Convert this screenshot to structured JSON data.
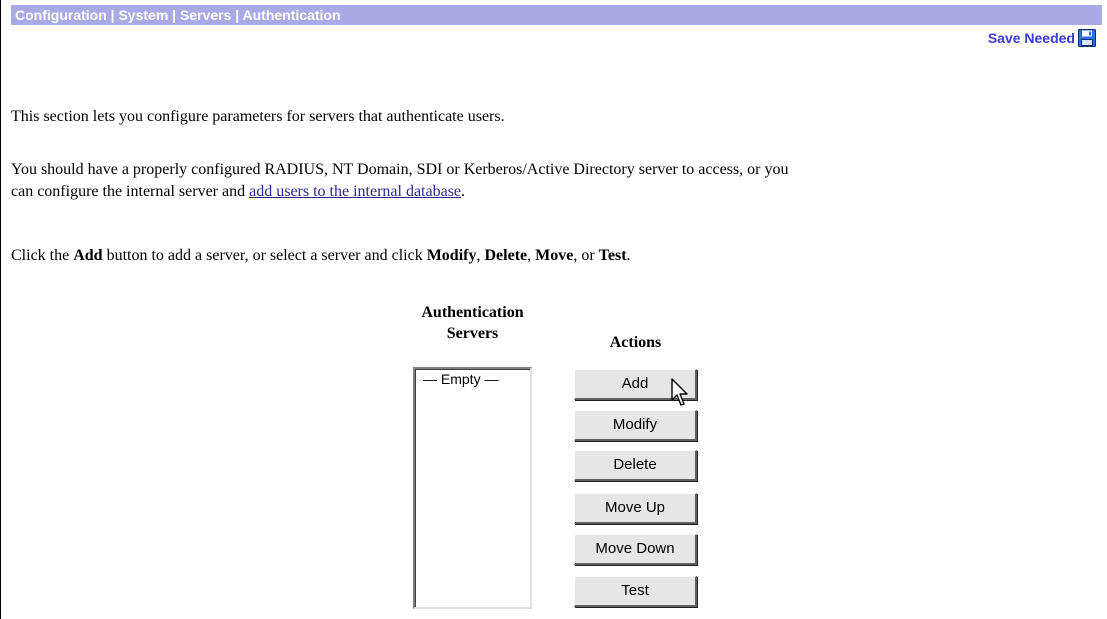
{
  "breadcrumb": "Configuration | System | Servers | Authentication",
  "save_needed": {
    "label": "Save Needed",
    "icon": "floppy-disk-icon"
  },
  "intro": "This section lets you configure parameters for servers that authenticate users.",
  "requirements": {
    "line1": "You should have a properly configured RADIUS, NT Domain, SDI or Kerberos/Active Directory server to access, or you",
    "line2_prefix": "can configure the internal server and ",
    "link": "add users to the internal database",
    "line2_suffix": "."
  },
  "instructions": {
    "t1": "Click the ",
    "b1": "Add",
    "t2": " button to add a server, or select a server and click ",
    "b2": "Modify",
    "t3": ", ",
    "b3": "Delete",
    "t4": ", ",
    "b4": "Move",
    "t5": ", or ",
    "b5": "Test",
    "t6": "."
  },
  "servers_header": {
    "line1": "Authentication",
    "line2": "Servers"
  },
  "actions_header": "Actions",
  "server_list": {
    "items": [
      "— Empty —"
    ]
  },
  "buttons": {
    "add": "Add",
    "modify": "Modify",
    "delete": "Delete",
    "move_up": "Move Up",
    "move_down": "Move Down",
    "test": "Test"
  },
  "colors": {
    "header_bar": "#a9a9e6",
    "header_text": "#ffffff",
    "save_needed_text": "#3a3ad4",
    "link": "#2a2a8c",
    "button_face": "#e6e6e6"
  }
}
